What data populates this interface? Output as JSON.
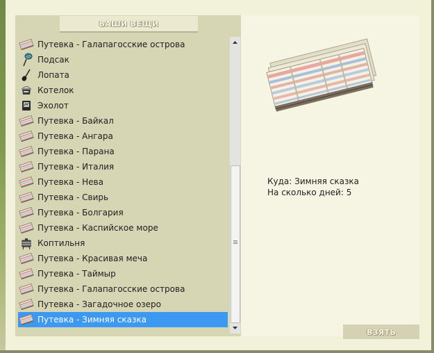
{
  "inventory": {
    "title": "ВАШИ ВЕЩИ",
    "items": [
      {
        "label": "Путевка - Галапагосские острова",
        "icon": "ticket-icon"
      },
      {
        "label": "Подсак",
        "icon": "landing-net-icon"
      },
      {
        "label": "Лопата",
        "icon": "shovel-icon"
      },
      {
        "label": "Котелок",
        "icon": "pot-icon"
      },
      {
        "label": "Эхолот",
        "icon": "echo-sounder-icon"
      },
      {
        "label": "Путевка - Байкал",
        "icon": "ticket-icon"
      },
      {
        "label": "Путевка - Ангара",
        "icon": "ticket-icon"
      },
      {
        "label": "Путевка - Парана",
        "icon": "ticket-icon"
      },
      {
        "label": "Путевка - Италия",
        "icon": "ticket-icon"
      },
      {
        "label": "Путевка - Нева",
        "icon": "ticket-icon"
      },
      {
        "label": "Путевка - Свирь",
        "icon": "ticket-icon"
      },
      {
        "label": "Путевка - Болгария",
        "icon": "ticket-icon"
      },
      {
        "label": "Путевка - Каспийское море",
        "icon": "ticket-icon"
      },
      {
        "label": "Коптильня",
        "icon": "smoker-icon"
      },
      {
        "label": "Путевка - Красивая меча",
        "icon": "ticket-icon"
      },
      {
        "label": "Путевка - Таймыр",
        "icon": "ticket-icon"
      },
      {
        "label": "Путевка - Галапагосские острова",
        "icon": "ticket-icon"
      },
      {
        "label": "Путевка - Загадочное озеро",
        "icon": "ticket-icon"
      },
      {
        "label": "Путевка - Зимняя сказка",
        "icon": "ticket-icon",
        "selected": true
      }
    ]
  },
  "details": {
    "destination_label": "Куда:",
    "destination_value": "Зимняя сказка",
    "days_label": "На сколько дней:",
    "days_value": "5"
  },
  "take_button": "ВЗЯТЬ",
  "colors": {
    "selection": "#3c98f0",
    "list_bg": "#d6d5b4",
    "detail_bg": "#f6f5e4"
  }
}
